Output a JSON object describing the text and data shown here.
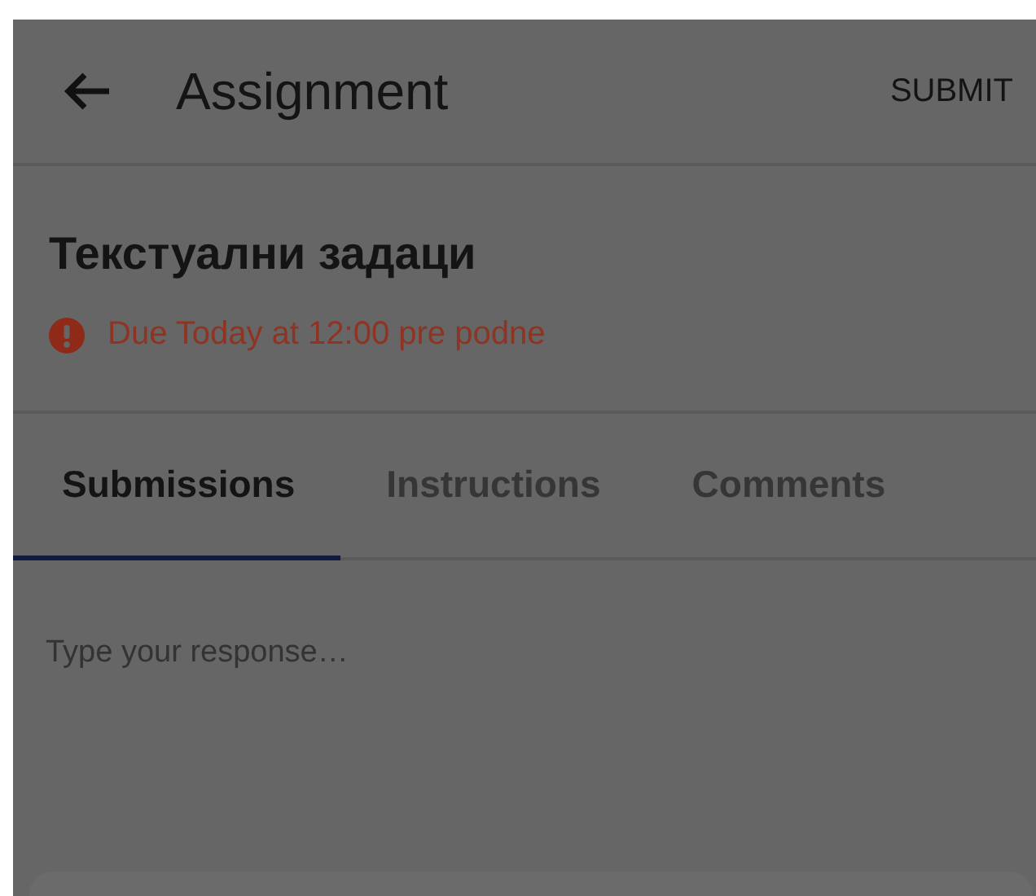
{
  "app_bar": {
    "title": "Assignment",
    "action": "SUBMIT"
  },
  "assignment": {
    "title": "Текстуални задаци",
    "due": "Due Today at 12:00 pre podne",
    "overdue": true
  },
  "tabs": [
    {
      "label": "Submissions",
      "selected": true
    },
    {
      "label": "Instructions",
      "selected": false
    },
    {
      "label": "Comments",
      "selected": false
    }
  ],
  "response": {
    "placeholder": "Type your response…"
  }
}
